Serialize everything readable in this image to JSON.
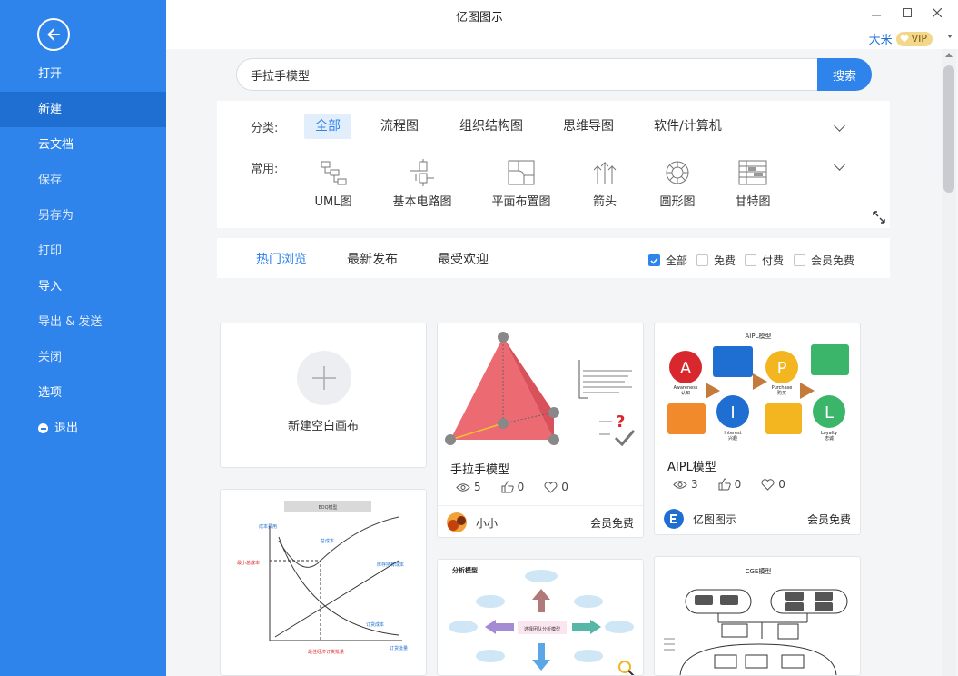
{
  "app": {
    "title": "亿图图示"
  },
  "user": {
    "name": "大米",
    "badge": "VIP"
  },
  "sidebar": {
    "items": [
      {
        "label": "打开"
      },
      {
        "label": "新建"
      },
      {
        "label": "云文档"
      },
      {
        "label": "保存"
      },
      {
        "label": "另存为"
      },
      {
        "label": "打印"
      },
      {
        "label": "导入"
      },
      {
        "label": "导出 & 发送"
      },
      {
        "label": "关闭"
      },
      {
        "label": "选项"
      },
      {
        "label": "退出"
      }
    ]
  },
  "search": {
    "value": "手拉手模型",
    "button": "搜索"
  },
  "filter": {
    "category_label": "分类:",
    "categories": [
      "全部",
      "流程图",
      "组织结构图",
      "思维导图",
      "软件/计算机"
    ],
    "common_label": "常用:",
    "common": [
      "UML图",
      "基本电路图",
      "平面布置图",
      "箭头",
      "圆形图",
      "甘特图"
    ]
  },
  "tabs": {
    "items": [
      "热门浏览",
      "最新发布",
      "最受欢迎"
    ]
  },
  "checks": {
    "items": [
      "全部",
      "免费",
      "付费",
      "会员免费"
    ]
  },
  "colors": {
    "accent": "#2e84ea",
    "sidebar": "#2e84ea",
    "sidebar_active": "#1f6fd3"
  },
  "cards": {
    "blank": {
      "label": "新建空白画布"
    },
    "hand": {
      "title": "手拉手模型",
      "views": "5",
      "likes": "0",
      "favs": "0",
      "author": "小小",
      "price": "会员免费"
    },
    "aipl": {
      "title": "AIPL模型",
      "views": "3",
      "likes": "0",
      "favs": "0",
      "author": "亿图图示",
      "price": "会员免费",
      "header": "AIPL模型",
      "nodes": {
        "a": "A",
        "p": "P",
        "i": "I",
        "l": "L"
      },
      "labels": {
        "awareness": "Awareness",
        "awareness_cn": "认知",
        "purchase": "Purchase",
        "purchase_cn": "购买",
        "interest": "Interest",
        "interest_cn": "兴趣",
        "loyalty": "Loyalty",
        "loyalty_cn": "忠诚"
      }
    },
    "eoq": {
      "header": "EOQ模型",
      "y_label": "成本费用",
      "min_cost": "最小总成本",
      "total_cost": "总成本",
      "holding_cost": "库存持有成本",
      "order_cost": "订货成本",
      "order_qty": "订货批量",
      "eoq": "最佳经济订货批量"
    },
    "analysis": {
      "header": "分析模型",
      "center": "选择团队分析模型"
    },
    "cge": {
      "header": "CGE模型"
    }
  }
}
